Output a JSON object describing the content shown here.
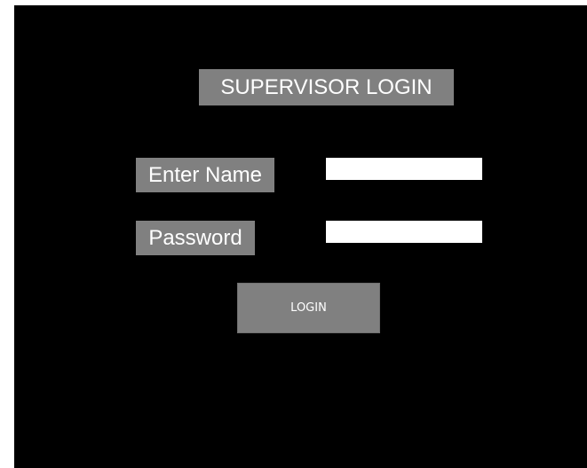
{
  "login": {
    "title": "SUPERVISOR LOGIN",
    "name_label": "Enter Name",
    "name_value": "",
    "password_label": "Password",
    "password_value": "",
    "button_label": "LOGIN"
  },
  "colors": {
    "background": "#000000",
    "label_background": "#808080",
    "text": "#ffffff",
    "input_background": "#ffffff"
  }
}
